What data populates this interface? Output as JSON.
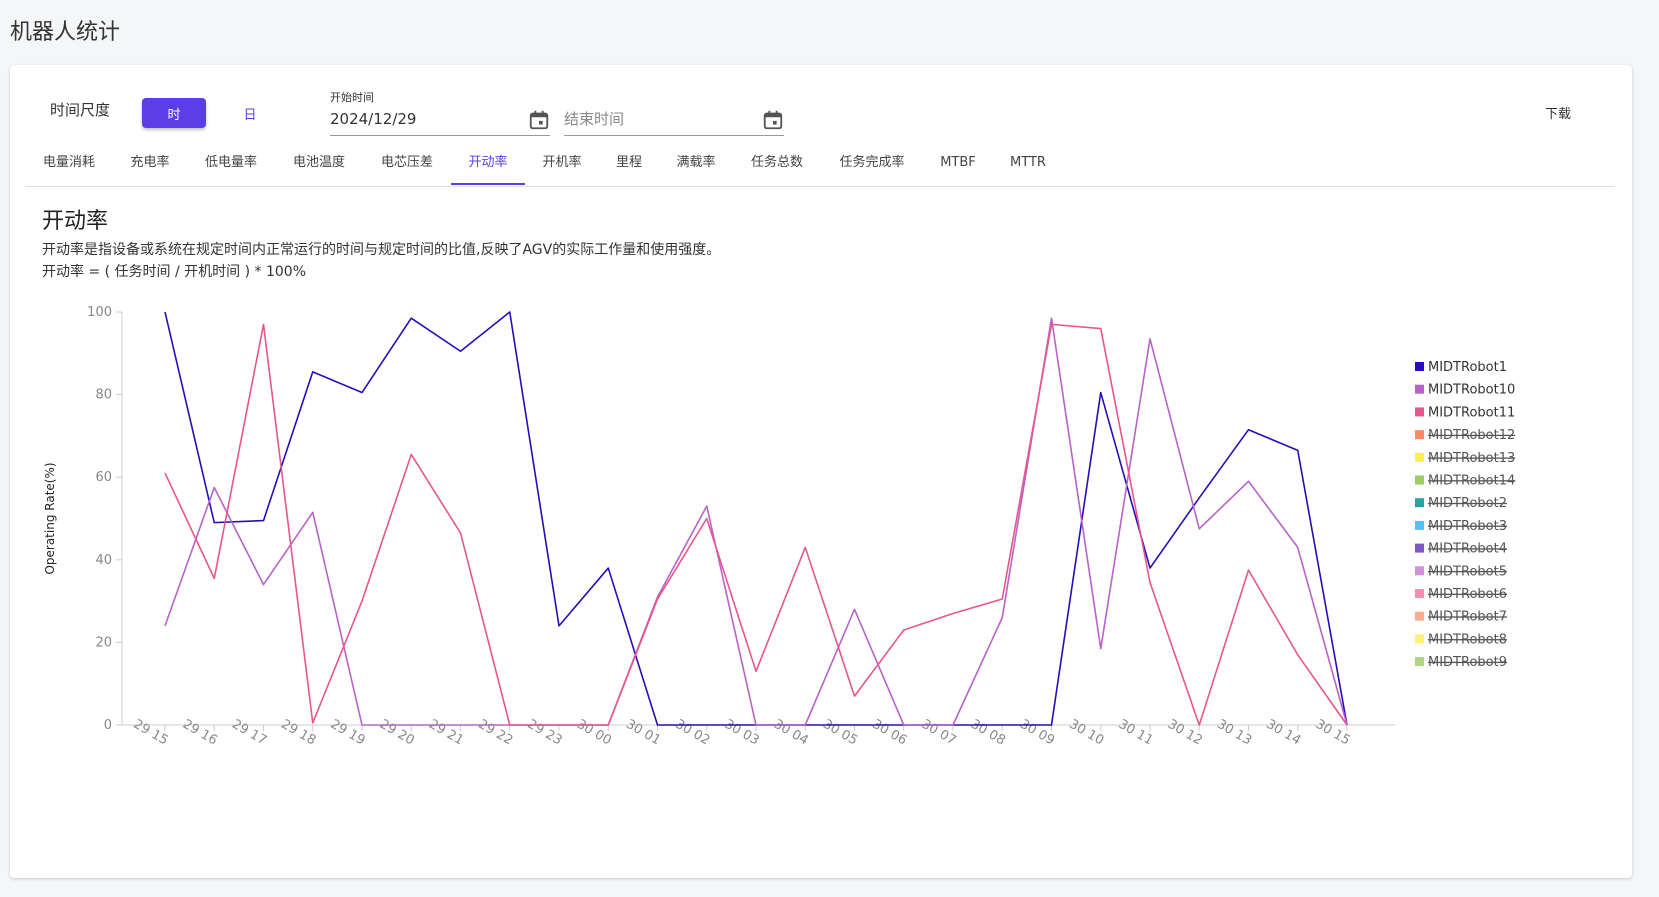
{
  "page": {
    "title": "机器人统计"
  },
  "controls": {
    "scale_label": "时间尺度",
    "hour_button": "时",
    "day_button": "日",
    "start_label": "开始时间",
    "start_value": "2024/12/29",
    "end_placeholder": "结束时间",
    "download_label": "下载"
  },
  "tabs": [
    {
      "label": "电量消耗"
    },
    {
      "label": "充电率"
    },
    {
      "label": "低电量率"
    },
    {
      "label": "电池温度"
    },
    {
      "label": "电芯压差"
    },
    {
      "label": "开动率",
      "active": true
    },
    {
      "label": "开机率"
    },
    {
      "label": "里程"
    },
    {
      "label": "满载率"
    },
    {
      "label": "任务总数"
    },
    {
      "label": "任务完成率"
    },
    {
      "label": "MTBF"
    },
    {
      "label": "MTTR"
    }
  ],
  "section": {
    "title": "开动率",
    "description": "开动率是指设备或系统在规定时间内正常运行的时间与规定时间的比值,反映了AGV的实际工作量和使用强度。",
    "formula": "开动率 = ( 任务时间 / 开机时间 ) * 100%"
  },
  "colors": {
    "accent": "#5b3ee6"
  },
  "chart_data": {
    "type": "line",
    "ylabel": "Operating Rate(%)",
    "ylim": [
      0,
      100
    ],
    "yticks": [
      0,
      20,
      40,
      60,
      80,
      100
    ],
    "grid": false,
    "legend_position": "right",
    "categories": [
      "29 15",
      "29 16",
      "29 17",
      "29 18",
      "29 19",
      "29 20",
      "29 21",
      "29 22",
      "29 23",
      "30 00",
      "30 01",
      "30 02",
      "30 03",
      "30 04",
      "30 05",
      "30 06",
      "30 07",
      "30 08",
      "30 09",
      "30 10",
      "30 11",
      "30 12",
      "30 13",
      "30 14",
      "30 15"
    ],
    "series": [
      {
        "name": "MIDTRobot1",
        "color": "#2a0bb8",
        "visible": true,
        "values": [
          100,
          49,
          49.5,
          85.5,
          80.5,
          98.5,
          90.5,
          100,
          24,
          38,
          0,
          0,
          0,
          0,
          0,
          0,
          0,
          0,
          0,
          80.5,
          38,
          55,
          71.5,
          66.5,
          0
        ]
      },
      {
        "name": "MIDTRobot10",
        "color": "#b863c8",
        "visible": true,
        "values": [
          24,
          57.5,
          34,
          51.5,
          0,
          0,
          0,
          0,
          0,
          0,
          31,
          53,
          0,
          0,
          28,
          0,
          0,
          26,
          98.5,
          18.5,
          93.5,
          47.5,
          59,
          43,
          0
        ]
      },
      {
        "name": "MIDTRobot11",
        "color": "#e8568d",
        "visible": true,
        "values": [
          61,
          35.5,
          97,
          0.5,
          30,
          65.5,
          46.5,
          0,
          0,
          0,
          30.5,
          50,
          13,
          43,
          7,
          23,
          27,
          30.5,
          97,
          96,
          34.5,
          0,
          37.5,
          17,
          0
        ]
      },
      {
        "name": "MIDTRobot12",
        "color": "#ff8a65",
        "visible": false,
        "values": []
      },
      {
        "name": "MIDTRobot13",
        "color": "#ffee58",
        "visible": false,
        "values": []
      },
      {
        "name": "MIDTRobot14",
        "color": "#9ccc65",
        "visible": false,
        "values": []
      },
      {
        "name": "MIDTRobot2",
        "color": "#26a69a",
        "visible": false,
        "values": []
      },
      {
        "name": "MIDTRobot3",
        "color": "#4fc3f7",
        "visible": false,
        "values": []
      },
      {
        "name": "MIDTRobot4",
        "color": "#7e57c2",
        "visible": false,
        "values": []
      },
      {
        "name": "MIDTRobot5",
        "color": "#ce93d8",
        "visible": false,
        "values": []
      },
      {
        "name": "MIDTRobot6",
        "color": "#f48fb1",
        "visible": false,
        "values": []
      },
      {
        "name": "MIDTRobot7",
        "color": "#ffab91",
        "visible": false,
        "values": []
      },
      {
        "name": "MIDTRobot8",
        "color": "#fff176",
        "visible": false,
        "values": []
      },
      {
        "name": "MIDTRobot9",
        "color": "#aed581",
        "visible": false,
        "values": []
      }
    ]
  }
}
